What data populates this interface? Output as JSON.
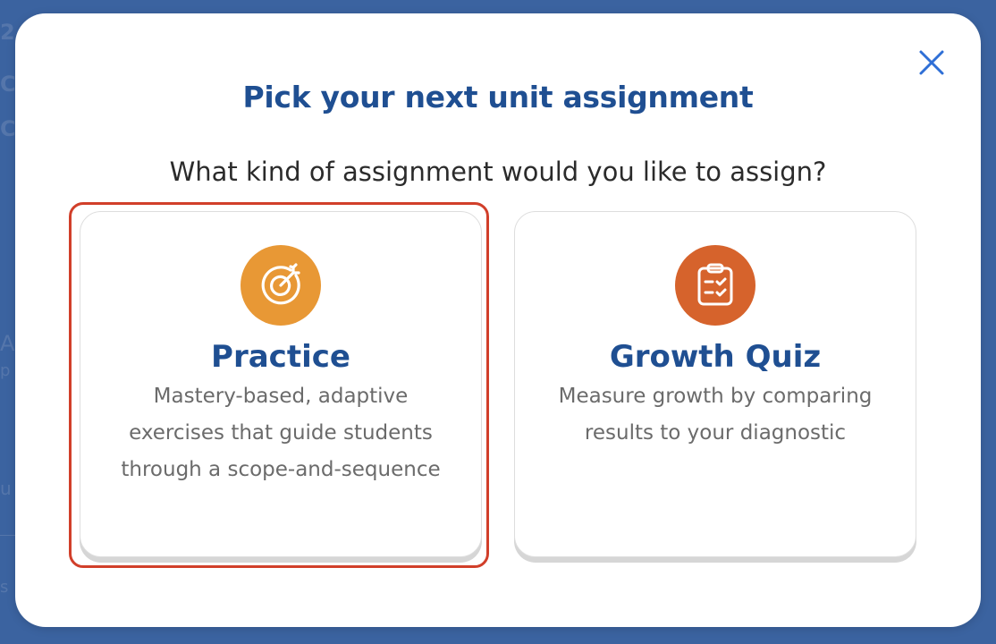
{
  "background": {
    "peek_glyphs": [
      "2",
      "C",
      "C",
      "A",
      "p",
      "u",
      "s"
    ]
  },
  "modal": {
    "title": "Pick your next unit assignment",
    "subtitle": "What kind of assignment would you like to assign?",
    "close_icon": "close-icon",
    "options": [
      {
        "title": "Practice",
        "description": "Mastery-based, adaptive exercises that guide students through a scope-and-sequence",
        "icon": "target-icon",
        "icon_color": "#e89835",
        "selected": true
      },
      {
        "title": "Growth Quiz",
        "description": "Measure growth by comparing results to your diagnostic",
        "icon": "clipboard-check-icon",
        "icon_color": "#d6632c",
        "selected": false
      }
    ]
  },
  "colors": {
    "backdrop": "#3b63a0",
    "title": "#1f4f92",
    "selection_border": "#d13f2a",
    "close": "#2f6fd6"
  }
}
